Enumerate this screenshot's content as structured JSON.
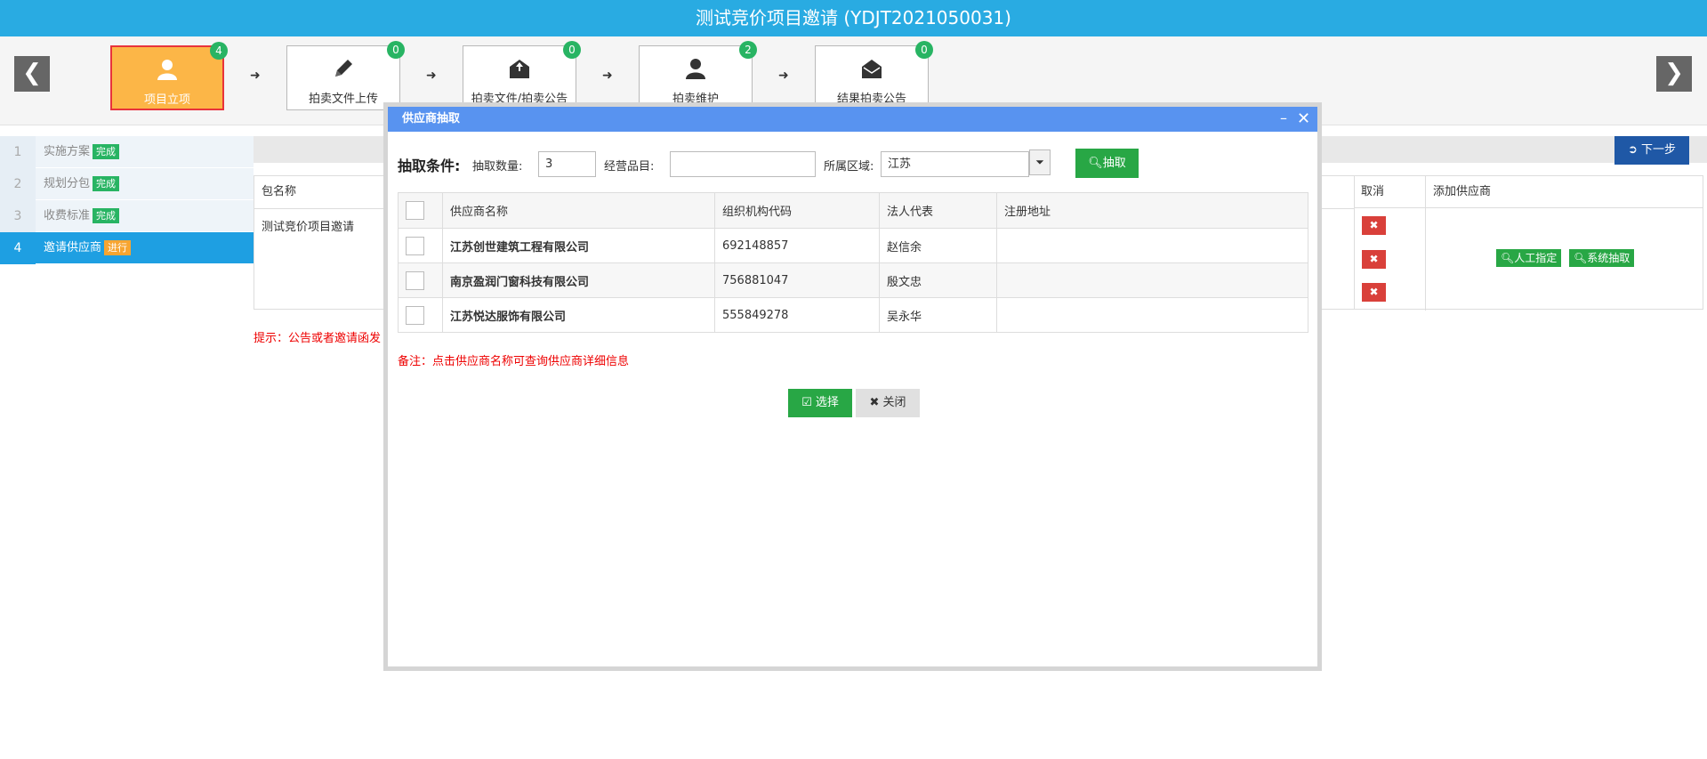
{
  "header": {
    "title": "测试竞价项目邀请 (YDJT2021050031)"
  },
  "steps": [
    {
      "label": "项目立项",
      "badge": "4",
      "icon": "user-icon"
    },
    {
      "label": "拍卖文件上传",
      "badge": "0",
      "icon": "pencil-icon"
    },
    {
      "label": "拍卖文件/拍卖公告",
      "badge": "0",
      "icon": "envelope-upload-icon"
    },
    {
      "label": "拍卖维护",
      "badge": "2",
      "icon": "user-icon"
    },
    {
      "label": "结果拍卖公告",
      "badge": "0",
      "icon": "envelope-icon"
    }
  ],
  "nav": {
    "prev": "❮",
    "next": "❯",
    "flow_arrow": "➜"
  },
  "sidebar": {
    "items": [
      {
        "num": "1",
        "label": "实施方案",
        "status": "完成"
      },
      {
        "num": "2",
        "label": "规划分包",
        "status": "完成"
      },
      {
        "num": "3",
        "label": "收费标准",
        "status": "完成"
      },
      {
        "num": "4",
        "label": "邀请供应商",
        "status": "进行"
      }
    ]
  },
  "background": {
    "next_label": "下一步",
    "col_package": "包名称",
    "package_name": "测试竞价项目邀请",
    "col_cancel": "取消",
    "col_add": "添加供应商",
    "manual_btn": "人工指定",
    "system_btn": "系统抽取",
    "hint": "提示：公告或者邀请函发"
  },
  "modal": {
    "title": "供应商抽取",
    "minimize": "–",
    "close": "✕",
    "cond_label": "抽取条件:",
    "qty_label": "抽取数量:",
    "qty_value": "3",
    "category_label": "经营品目:",
    "category_value": "",
    "region_label": "所属区域:",
    "region_value": "江苏",
    "search_btn": "抽取",
    "table": {
      "headers": [
        "供应商名称",
        "组织机构代码",
        "法人代表",
        "注册地址"
      ],
      "rows": [
        {
          "name": "江苏创世建筑工程有限公司",
          "code": "692148857",
          "rep": "赵信余",
          "addr": ""
        },
        {
          "name": "南京盈润门窗科技有限公司",
          "code": "756881047",
          "rep": "殷文忠",
          "addr": ""
        },
        {
          "name": "江苏悦达服饰有限公司",
          "code": "555849278",
          "rep": "吴永华",
          "addr": ""
        }
      ]
    },
    "note": "备注：点击供应商名称可查询供应商详细信息",
    "select_btn": "选择",
    "close_btn": "关闭"
  },
  "colors": {
    "title_bar": "#29abe2",
    "active_step": "#fcb647",
    "badge": "#28b463",
    "modal_header": "#5893f0",
    "primary_green": "#28a745",
    "danger": "#d9403a",
    "next_button": "#1f58a6"
  }
}
